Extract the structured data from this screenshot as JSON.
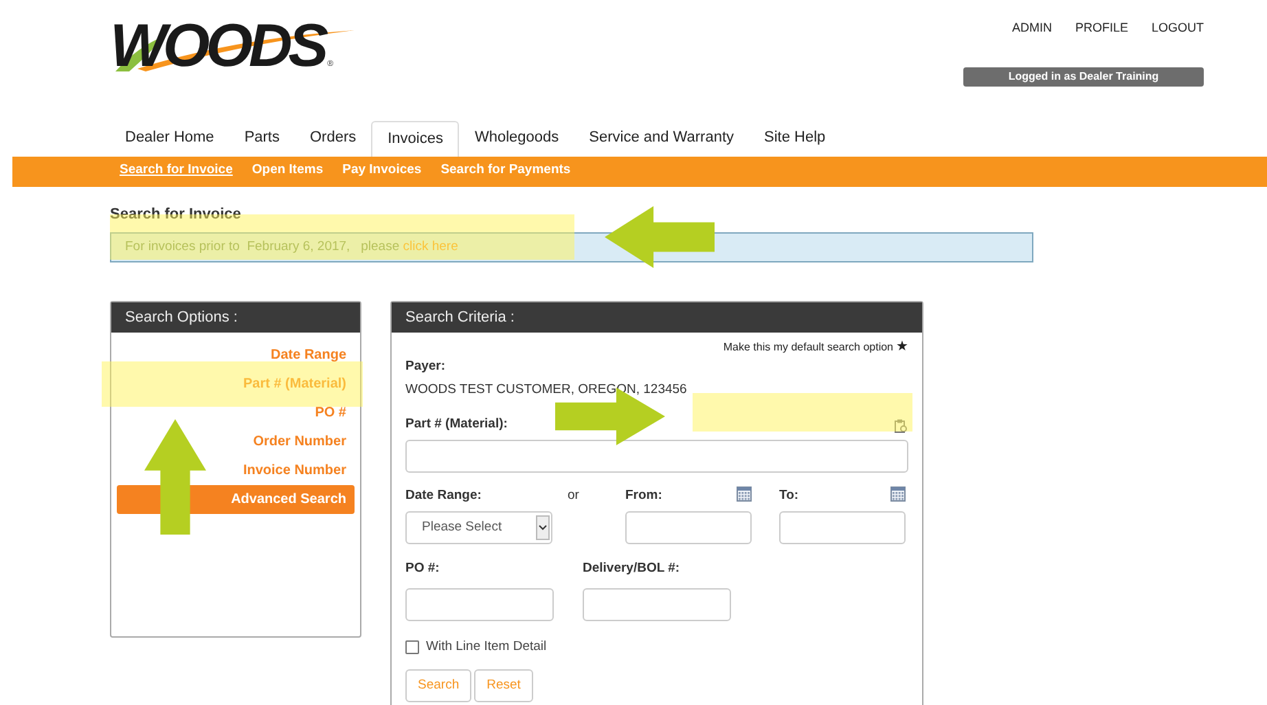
{
  "logo": {
    "text": "WOODS",
    "mark": "®"
  },
  "top_links": [
    "ADMIN",
    "PROFILE",
    "LOGOUT"
  ],
  "login_status": "Logged in as Dealer Training",
  "tabs": [
    {
      "label": "Dealer Home",
      "selected": false
    },
    {
      "label": "Parts",
      "selected": false
    },
    {
      "label": "Orders",
      "selected": false
    },
    {
      "label": "Invoices",
      "selected": true
    },
    {
      "label": "Wholegoods",
      "selected": false
    },
    {
      "label": "Service and Warranty",
      "selected": false
    },
    {
      "label": "Site Help",
      "selected": false
    }
  ],
  "subnav": [
    {
      "label": "Search for Invoice",
      "selected": true
    },
    {
      "label": "Open Items",
      "selected": false
    },
    {
      "label": "Pay Invoices",
      "selected": false
    },
    {
      "label": "Search for Payments",
      "selected": false
    }
  ],
  "page_title": "Search for Invoice",
  "notice": {
    "text": "For invoices prior to  February 6, 2017,   please",
    "link": "click here"
  },
  "search_options": {
    "title": "Search Options :",
    "items": [
      {
        "label": "Date Range",
        "selected": false
      },
      {
        "label": "Part # (Material)",
        "selected": false
      },
      {
        "label": "PO #",
        "selected": false
      },
      {
        "label": "Order Number",
        "selected": false
      },
      {
        "label": "Invoice Number",
        "selected": false
      },
      {
        "label": "Advanced Search",
        "selected": true
      }
    ]
  },
  "criteria": {
    "title": "Search Criteria :",
    "default_option": "Make this my default search option",
    "star": "★",
    "payer_label": "Payer:",
    "payer_value": "WOODS TEST CUSTOMER, OREGON, 123456",
    "part_label": "Part # (Material):",
    "date_range_label": "Date Range:",
    "date_range_placeholder": "Please Select",
    "or": "or",
    "from_label": "From:",
    "to_label": "To:",
    "po_label": "PO #:",
    "delivery_label": "Delivery/BOL #:",
    "line_item": {
      "label": "With Line Item Detail",
      "checked": false
    },
    "buttons": [
      "Search",
      "Reset"
    ]
  }
}
